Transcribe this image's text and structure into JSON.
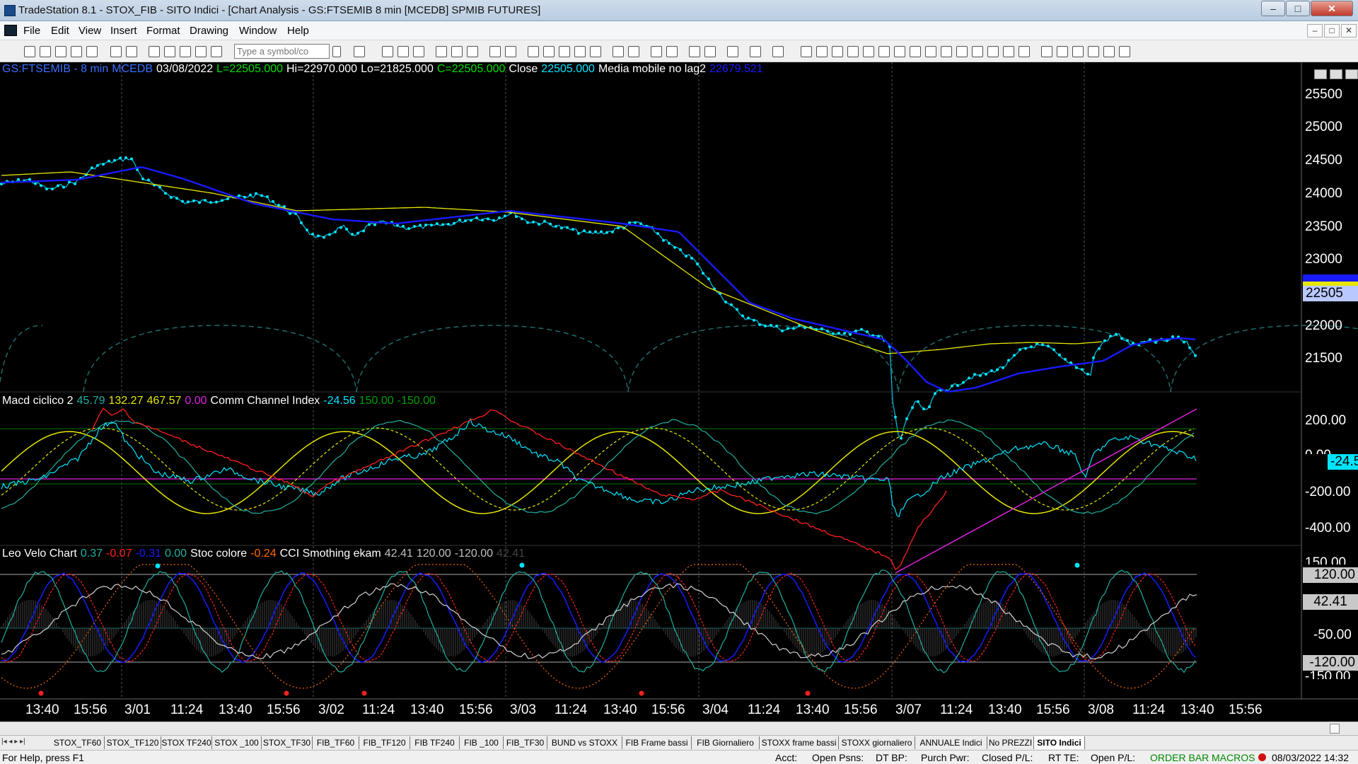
{
  "window": {
    "title": "TradeStation 8.1 - STOX_FIB - SITO Indici - [Chart Analysis - GS:FTSEMIB  8 min  [MCEDB] SPMIB FUTURES]",
    "min": "–",
    "max": "□",
    "close": "✕"
  },
  "menu": [
    "File",
    "Edit",
    "View",
    "Insert",
    "Format",
    "Drawing",
    "Window",
    "Help"
  ],
  "mdi": {
    "min": "–",
    "restore": "□",
    "close": "✕"
  },
  "toolbar": {
    "symbol_placeholder": "Type a symbol/co"
  },
  "colors": {
    "background": "#000000",
    "price": "#00e5ff",
    "avg_blue": "#1a1aff",
    "avg_yellow": "#e6e600",
    "macd_red": "#ff2020",
    "magenta": "#e020e0",
    "teal": "#20b0a0",
    "green_line": "#009000"
  },
  "price_pane": {
    "label": [
      {
        "text": "GS:FTSEMIB - 8 min",
        "color": "#3a70ff"
      },
      {
        "text": "MCEDB",
        "color": "#3a70ff"
      },
      {
        "text": "03/08/2022",
        "color": "#ffffff"
      },
      {
        "text": "L=22505.000",
        "color": "#00e000"
      },
      {
        "text": "Hi=22970.000",
        "color": "#ffffff"
      },
      {
        "text": "Lo=21825.000",
        "color": "#ffffff"
      },
      {
        "text": "C=22505.000",
        "color": "#00e000"
      },
      {
        "text": "Close",
        "color": "#ffffff"
      },
      {
        "text": "22505.000",
        "color": "#00e5ff"
      },
      {
        "text": "Media mobile no lag2",
        "color": "#ffffff"
      },
      {
        "text": "22679.521",
        "color": "#1a1aff"
      }
    ],
    "axis": [
      "25500",
      "25000",
      "24500",
      "24000",
      "23500",
      "23000",
      "22000",
      "21500"
    ],
    "last_tag": "22505",
    "hidden_tag": "22679"
  },
  "macd_pane": {
    "label": [
      {
        "text": "Macd ciclico 2",
        "color": "#ffffff"
      },
      {
        "text": "45.79",
        "color": "#20b0a0"
      },
      {
        "text": "132.27",
        "color": "#e6e600"
      },
      {
        "text": "467.57",
        "color": "#e6e600"
      },
      {
        "text": "0.00",
        "color": "#e020e0"
      },
      {
        "text": "Comm Channel Index",
        "color": "#ffffff"
      },
      {
        "text": "-24.56",
        "color": "#00e5ff"
      },
      {
        "text": "150.00",
        "color": "#00a000"
      },
      {
        "text": "-150.00",
        "color": "#00a000"
      }
    ],
    "axis": [
      "200.00",
      "-200.00",
      "-400.00"
    ],
    "last_tag": "-24.56",
    "hidden_tag": "0.00"
  },
  "osc_pane": {
    "label": [
      {
        "text": "Leo Velo Chart",
        "color": "#ffffff"
      },
      {
        "text": "0.37",
        "color": "#20b0a0"
      },
      {
        "text": "-0.07",
        "color": "#ff2020"
      },
      {
        "text": "-0.31",
        "color": "#1a1aff"
      },
      {
        "text": "0.00",
        "color": "#20b0a0"
      },
      {
        "text": "Stoc colore",
        "color": "#ffffff"
      },
      {
        "text": "-0.24",
        "color": "#ff6a00"
      },
      {
        "text": "CCI Smothing ekam",
        "color": "#ffffff"
      },
      {
        "text": "42.41",
        "color": "#c0c0c0"
      },
      {
        "text": "120.00",
        "color": "#c0c0c0"
      },
      {
        "text": "-120.00",
        "color": "#c0c0c0"
      },
      {
        "text": "42.41",
        "color": "#444444"
      }
    ],
    "axis": [
      "150.00",
      "-50.00",
      "-150.00"
    ],
    "tag_120": "120.00",
    "tag_4241": "42.41",
    "tag_m120": "-120.00"
  },
  "time_axis": [
    "13:40",
    "15:56",
    "3/01",
    "11:24",
    "13:40",
    "15:56",
    "3/02",
    "11:24",
    "13:40",
    "15:56",
    "3/03",
    "11:24",
    "13:40",
    "15:56",
    "3/04",
    "11:24",
    "13:40",
    "15:56",
    "3/07",
    "11:24",
    "13:40",
    "15:56",
    "3/08",
    "11:24",
    "13:40",
    "15:56"
  ],
  "tabs": [
    "STOX_TF60",
    "STOX_TF120",
    "STOX TF240",
    "STOX _100",
    "STOX_TF30",
    "FIB_TF60",
    "FIB_TF120",
    "FIB TF240",
    "FIB _100",
    "FIB_TF30",
    "BUND vs STOXX",
    "FIB Frame bassi",
    "FIB Giornaliero",
    "STOXX frame bassi",
    "STOXX giornaliero",
    "ANNUALE Indici",
    "No PREZZI",
    "SITO Indici"
  ],
  "status": {
    "help": "For Help, press F1",
    "acct": "Acct:",
    "open_psns": "Open Psns:",
    "dt_bp": "DT BP:",
    "purch_pwr": "Purch Pwr:",
    "closed_pl": "Closed P/L:",
    "rt_te": "RT TE:",
    "open_pl": "Open P/L:",
    "order_bar": "ORDER BAR",
    "macros": "MACROS",
    "datetime": "08/03/2022 14:32"
  }
}
